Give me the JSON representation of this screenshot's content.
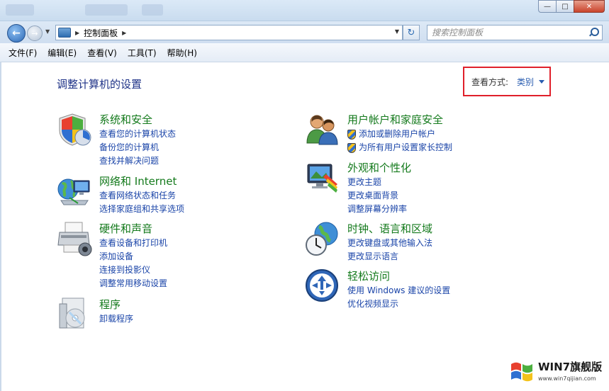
{
  "window": {
    "close_glyph": "✕",
    "max_glyph": "□",
    "min_glyph": "—"
  },
  "nav": {
    "back_glyph": "←",
    "forward_glyph": "→",
    "address_icon": "control-panel-icon",
    "breadcrumb": "控制面板",
    "search_placeholder": "搜索控制面板"
  },
  "menu": [
    "文件(F)",
    "编辑(E)",
    "查看(V)",
    "工具(T)",
    "帮助(H)"
  ],
  "page": {
    "title": "调整计算机的设置",
    "view_by_label": "查看方式:",
    "view_by_value": "类别",
    "highlight_color": "#e0202a"
  },
  "categories_left": [
    {
      "title": "系统和安全",
      "icon": "shield-flag-icon",
      "links": [
        {
          "text": "查看您的计算机状态",
          "shield": false
        },
        {
          "text": "备份您的计算机",
          "shield": false
        },
        {
          "text": "查找并解决问题",
          "shield": false
        }
      ]
    },
    {
      "title": "网络和 Internet",
      "icon": "network-globe-icon",
      "links": [
        {
          "text": "查看网络状态和任务",
          "shield": false
        },
        {
          "text": "选择家庭组和共享选项",
          "shield": false
        }
      ]
    },
    {
      "title": "硬件和声音",
      "icon": "printer-icon",
      "links": [
        {
          "text": "查看设备和打印机",
          "shield": false
        },
        {
          "text": "添加设备",
          "shield": false
        },
        {
          "text": "连接到投影仪",
          "shield": false
        },
        {
          "text": "调整常用移动设置",
          "shield": false
        }
      ]
    },
    {
      "title": "程序",
      "icon": "programs-disc-icon",
      "links": [
        {
          "text": "卸载程序",
          "shield": false
        }
      ]
    }
  ],
  "categories_right": [
    {
      "title": "用户帐户和家庭安全",
      "icon": "users-icon",
      "links": [
        {
          "text": "添加或删除用户帐户",
          "shield": true
        },
        {
          "text": "为所有用户设置家长控制",
          "shield": true
        }
      ]
    },
    {
      "title": "外观和个性化",
      "icon": "appearance-monitor-icon",
      "links": [
        {
          "text": "更改主题",
          "shield": false
        },
        {
          "text": "更改桌面背景",
          "shield": false
        },
        {
          "text": "调整屏幕分辨率",
          "shield": false
        }
      ]
    },
    {
      "title": "时钟、语言和区域",
      "icon": "clock-globe-icon",
      "links": [
        {
          "text": "更改键盘或其他输入法",
          "shield": false
        },
        {
          "text": "更改显示语言",
          "shield": false
        }
      ]
    },
    {
      "title": "轻松访问",
      "icon": "ease-of-access-icon",
      "links": [
        {
          "text": "使用 Windows 建议的设置",
          "shield": false
        },
        {
          "text": "优化视频显示",
          "shield": false
        }
      ]
    }
  ],
  "watermark": {
    "title": "WIN7旗舰版",
    "url": "www.win7qijian.com"
  }
}
